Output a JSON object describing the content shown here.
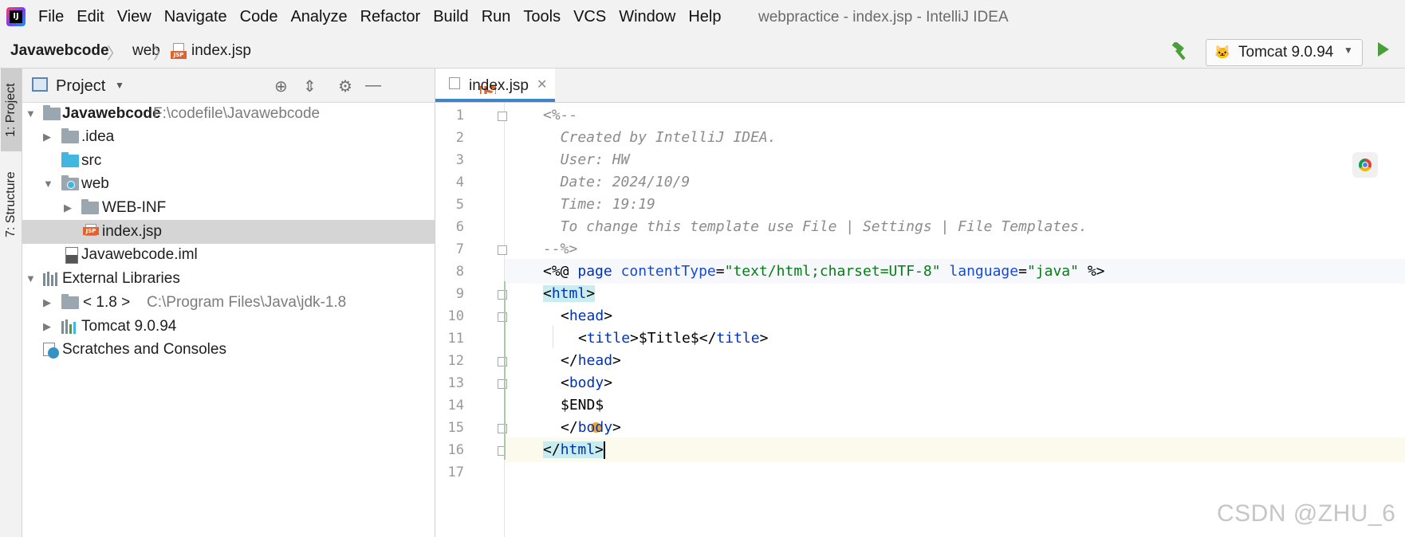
{
  "menubar": {
    "app_icon": "intellij-idea-icon",
    "items": [
      "File",
      "Edit",
      "View",
      "Navigate",
      "Code",
      "Analyze",
      "Refactor",
      "Build",
      "Run",
      "Tools",
      "VCS",
      "Window",
      "Help"
    ],
    "window_title": "webpractice - index.jsp - IntelliJ IDEA"
  },
  "breadcrumb": {
    "items": [
      "Javawebcode",
      "web",
      "index.jsp"
    ]
  },
  "run_config": {
    "label": "Tomcat 9.0.94",
    "icons": [
      "hammer-build-icon",
      "tomcat-icon",
      "chevron-down-icon",
      "run-play-icon"
    ]
  },
  "left_strip": {
    "tabs": [
      "1: Project",
      "7: Structure"
    ]
  },
  "project_panel": {
    "title": "Project",
    "tree": [
      {
        "label": "Javawebcode",
        "path": "F:\\codefile\\Javawebcode",
        "bold": true
      },
      {
        "label": ".idea"
      },
      {
        "label": "src"
      },
      {
        "label": "web"
      },
      {
        "label": "WEB-INF"
      },
      {
        "label": "index.jsp",
        "selected": true
      },
      {
        "label": "Javawebcode.iml"
      },
      {
        "label": "External Libraries"
      },
      {
        "label": "< 1.8 >",
        "path": "C:\\Program Files\\Java\\jdk-1.8"
      },
      {
        "label": "Tomcat 9.0.94"
      },
      {
        "label": "Scratches and Consoles"
      }
    ]
  },
  "editor": {
    "tab_label": "index.jsp",
    "line_numbers": [
      "1",
      "2",
      "3",
      "4",
      "5",
      "6",
      "7",
      "8",
      "9",
      "10",
      "11",
      "12",
      "13",
      "14",
      "15",
      "16",
      "17"
    ],
    "code": {
      "l1": "<%--",
      "l2": "  Created by IntelliJ IDEA.",
      "l3": "  User: HW",
      "l4": "  Date: 2024/10/9",
      "l5": "  Time: 19:19",
      "l6": "  To change this template use File | Settings | File Templates.",
      "l7": "--%>",
      "l8": {
        "open": "<%@ ",
        "page": "page",
        "attr1": "contentType",
        "eq1": "=",
        "val1": "\"text/html;charset=UTF-8\"",
        "attr2": "language",
        "eq2": "=",
        "val2": "\"java\"",
        "close": " %>"
      },
      "l9": {
        "open": "<",
        "name": "html",
        "close": ">"
      },
      "l10": {
        "open": "<",
        "name": "head",
        "close": ">"
      },
      "l11": {
        "open": "<",
        "name": "title",
        "mid": ">$Title$</",
        "name2": "title",
        "close": ">"
      },
      "l12": {
        "open": "</",
        "name": "head",
        "close": ">"
      },
      "l13": {
        "open": "<",
        "name": "body",
        "close": ">"
      },
      "l14": "$END$",
      "l15": {
        "open": "</",
        "name": "body",
        "close": ">"
      },
      "l16": {
        "open": "</",
        "name": "html",
        "close": ">"
      }
    }
  },
  "watermark": "CSDN @ZHU_6",
  "colors": {
    "tag": "#0033b3",
    "string": "#067d17",
    "comment": "#8c8c8c",
    "selection": "#d5d5d5",
    "accent": "#4083c9"
  }
}
